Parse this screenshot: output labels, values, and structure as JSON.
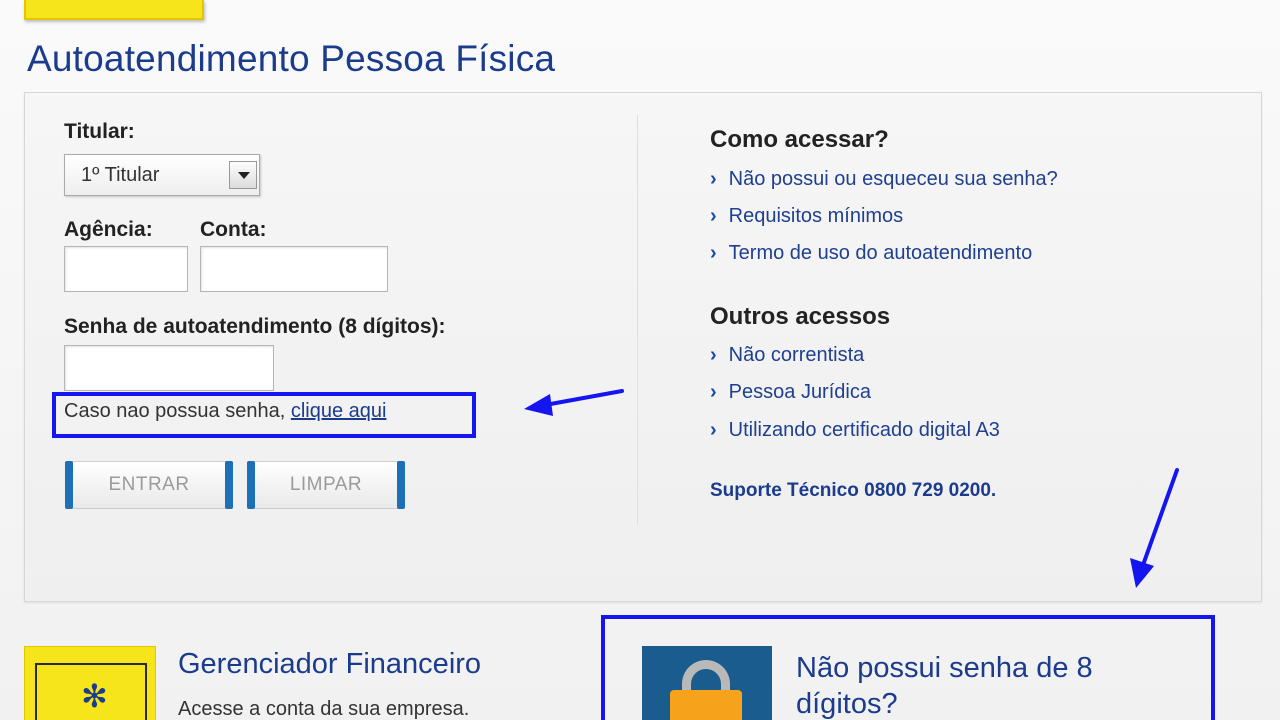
{
  "page_title": "Autoatendimento Pessoa Física",
  "login": {
    "titular_label": "Titular:",
    "titular_value": "1º Titular",
    "agencia_label": "Agência:",
    "conta_label": "Conta:",
    "senha_label": "Senha de autoatendimento (8 dígitos):",
    "hint_text": "Caso nao possua senha, ",
    "hint_link": "clique aqui",
    "entrar_label": "ENTRAR",
    "limpar_label": "LIMPAR"
  },
  "como_acessar": {
    "heading": "Como acessar?",
    "links": [
      "Não possui ou esqueceu sua senha?",
      "Requisitos mínimos",
      "Termo de uso do autoatendimento"
    ]
  },
  "outros_acessos": {
    "heading": "Outros acessos",
    "links": [
      "Não correntista",
      "Pessoa Jurídica",
      "Utilizando certificado digital A3"
    ]
  },
  "support_text": "Suporte Técnico 0800 729 0200.",
  "gerenciador": {
    "title": "Gerenciador Financeiro",
    "subtitle": "Acesse a conta da sua empresa."
  },
  "sem_senha": {
    "title": "Não possui senha de 8 dígitos?"
  },
  "colors": {
    "brand_yellow": "#f7e51b",
    "brand_blue": "#1b3b8c",
    "highlight_blue": "#1515f0"
  },
  "icons": [
    "dropdown-arrow-icon",
    "chevron-right-icon",
    "bb-logo-icon",
    "padlock-icon",
    "annotation-arrow-icon"
  ]
}
